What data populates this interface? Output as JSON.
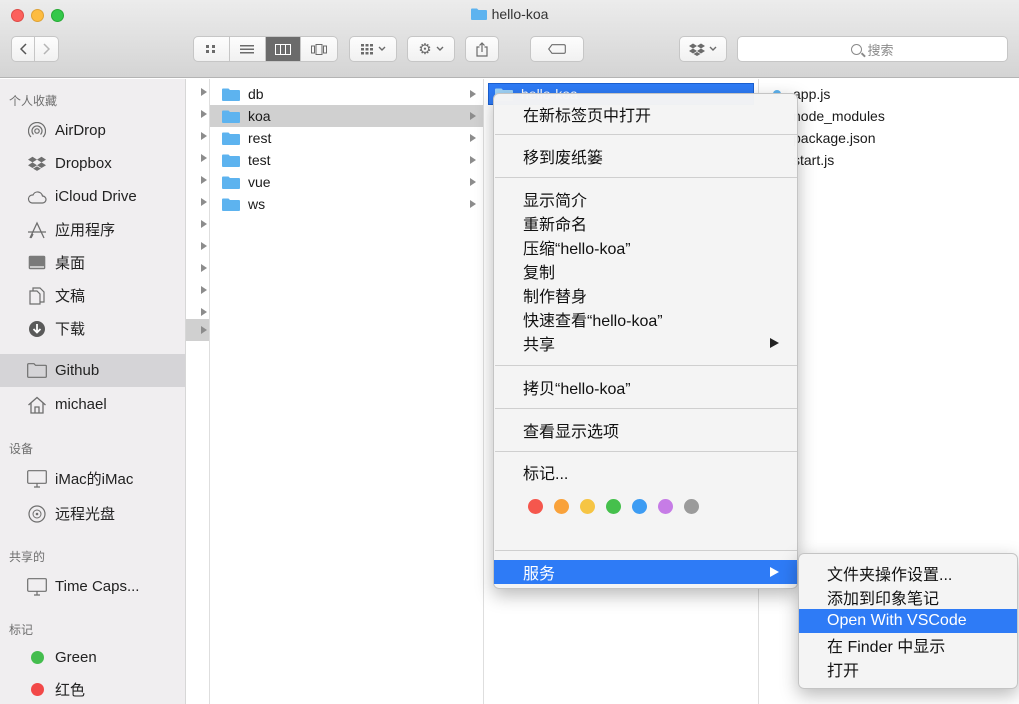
{
  "window": {
    "title": "hello-koa",
    "search_placeholder": "搜索"
  },
  "sidebar": {
    "sections": [
      {
        "header": "个人收藏",
        "items": [
          {
            "label": "AirDrop",
            "icon": "airdrop-icon"
          },
          {
            "label": "Dropbox",
            "icon": "dropbox-icon"
          },
          {
            "label": "iCloud Drive",
            "icon": "cloud-icon"
          },
          {
            "label": "应用程序",
            "icon": "applications-icon"
          },
          {
            "label": "桌面",
            "icon": "desktop-icon"
          },
          {
            "label": "文稿",
            "icon": "documents-icon"
          },
          {
            "label": "下载",
            "icon": "download-icon"
          },
          {
            "label": "Github",
            "icon": "folder-icon",
            "selected": true
          },
          {
            "label": "michael",
            "icon": "home-icon"
          }
        ]
      },
      {
        "header": "设备",
        "items": [
          {
            "label": "iMac的iMac",
            "icon": "monitor-icon"
          },
          {
            "label": "远程光盘",
            "icon": "disc-icon"
          }
        ]
      },
      {
        "header": "共享的",
        "items": [
          {
            "label": "Time Caps...",
            "icon": "monitor-icon"
          }
        ]
      },
      {
        "header": "标记",
        "items": [
          {
            "label": "Green",
            "icon": "tag-dot-icon",
            "color": "#44bd4e"
          },
          {
            "label": "红色",
            "icon": "tag-dot-icon",
            "color": "#f24848"
          }
        ]
      }
    ]
  },
  "columns": {
    "col2": [
      "db",
      "koa",
      "rest",
      "test",
      "vue",
      "ws"
    ],
    "col2_selected": "koa",
    "col3": [
      "hello-koa"
    ],
    "col4": [
      "app.js",
      "node_modules",
      "package.json",
      "start.js"
    ],
    "col4_visible": [
      "app.js",
      "node_modules",
      "package.json",
      "start.js"
    ]
  },
  "context_menu": {
    "items": [
      {
        "label": "在新标签页中打开"
      },
      {
        "label": "移到废纸篓"
      },
      {
        "label": "显示简介"
      },
      {
        "label": "重新命名"
      },
      {
        "label": "压缩“hello-koa”"
      },
      {
        "label": "复制"
      },
      {
        "label": "制作替身"
      },
      {
        "label": "快速查看“hello-koa”"
      },
      {
        "label": "共享",
        "submenu": true
      },
      {
        "label": "拷贝“hello-koa”"
      },
      {
        "label": "查看显示选项"
      },
      {
        "label": "标记..."
      },
      {
        "label": "服务",
        "submenu": true,
        "highlighted": true
      }
    ],
    "tag_colors": [
      "#f5574d",
      "#f9a23b",
      "#f6c544",
      "#45c04c",
      "#3d9cf3",
      "#c67ce6",
      "#9b9b9b"
    ]
  },
  "services_submenu": {
    "items": [
      {
        "label": "文件夹操作设置..."
      },
      {
        "label": "添加到印象笔记"
      },
      {
        "label": "Open With VSCode",
        "highlighted": true
      },
      {
        "label": "在 Finder 中显示"
      },
      {
        "label": "打开"
      }
    ]
  },
  "colors": {
    "accent": "#2e7bf6",
    "folder": "#5db3ef"
  }
}
